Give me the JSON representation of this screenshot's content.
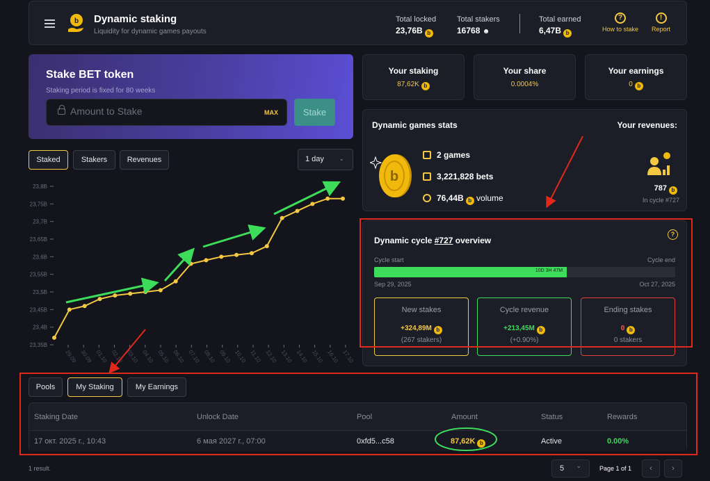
{
  "header": {
    "title": "Dynamic staking",
    "subtitle": "Liquidity for dynamic games payouts",
    "total_locked_label": "Total locked",
    "total_locked_value": "23,76B",
    "total_stakers_label": "Total stakers",
    "total_stakers_value": "16768",
    "total_earned_label": "Total earned",
    "total_earned_value": "6,47B",
    "how_to_stake": "How to stake",
    "report": "Report"
  },
  "stake": {
    "title": "Stake BET token",
    "subtitle": "Staking period is fixed for 80 weeks",
    "placeholder": "Amount to Stake",
    "max_label": "MAX",
    "button": "Stake"
  },
  "chart_tabs": [
    "Staked",
    "Stakers",
    "Revenues"
  ],
  "period": "1 day",
  "stat_cards": {
    "your_staking_label": "Your staking",
    "your_staking_value": "87,62K",
    "your_share_label": "Your share",
    "your_share_value": "0.0004%",
    "your_earnings_label": "Your earnings",
    "your_earnings_value": "0"
  },
  "games": {
    "title": "Dynamic games stats",
    "revenues_title": "Your revenues:",
    "games_count": "2 games",
    "bets": "3,221,828 bets",
    "volume_value": "76,44B",
    "volume_label": "volume",
    "revenue_value": "787",
    "revenue_cycle": "In cycle #727"
  },
  "cycle": {
    "title_pre": "Dynamic cycle",
    "title_link": "#727",
    "title_post": "overview",
    "start_label": "Cycle start",
    "end_label": "Cycle end",
    "remaining": "10D 3H 47M",
    "progress": 0.64,
    "start_date": "Sep 29, 2025",
    "end_date": "Oct 27, 2025",
    "new_stakes_label": "New stakes",
    "new_stakes_value": "+324,89M",
    "new_stakes_sub": "(267 stakers)",
    "cycle_revenue_label": "Cycle revenue",
    "cycle_revenue_value": "+213,45M",
    "cycle_revenue_sub": "(+0.90%)",
    "ending_stakes_label": "Ending stakes",
    "ending_stakes_value": "0",
    "ending_stakes_sub": "0 stakers"
  },
  "bottom_tabs": [
    "Pools",
    "My Staking",
    "My Earnings"
  ],
  "table": {
    "headers": [
      "Staking Date",
      "Unlock Date",
      "Pool",
      "Amount",
      "Status",
      "Rewards"
    ],
    "row": {
      "staking_date": "17 окт. 2025 г., 10:43",
      "unlock_date": "6 мая 2027 г., 07:00",
      "pool": "0xfd5...c58",
      "amount": "87,62K",
      "status": "Active",
      "rewards": "0.00%"
    }
  },
  "footer": {
    "results": "1 result.",
    "page_size": "5",
    "page_info": "Page 1 of 1"
  },
  "colors": {
    "accent": "#f5c842",
    "green": "#3ddc5a",
    "red": "#ff5a4a",
    "bg": "#13141c",
    "card": "#1b1d27"
  },
  "chart_data": {
    "type": "line",
    "x": [
      "29.09",
      "30.09",
      "01.10",
      "02.10",
      "03.10",
      "04.10",
      "05.10",
      "06.10",
      "07.10",
      "08.10",
      "09.10",
      "10.10",
      "11.10",
      "12.10",
      "13.10",
      "14.10",
      "15.10",
      "16.10",
      "17.10"
    ],
    "y_ticks": [
      "23,35B",
      "23,4B",
      "23,45B",
      "23,5B",
      "23,55B",
      "23,6B",
      "23,65B",
      "23,7B",
      "23,75B",
      "23,8B"
    ],
    "values": [
      23.37,
      23.45,
      23.46,
      23.48,
      23.49,
      23.495,
      23.5,
      23.505,
      23.53,
      23.58,
      23.59,
      23.6,
      23.605,
      23.61,
      23.63,
      23.71,
      23.73,
      23.75,
      23.765,
      23.765
    ],
    "ylim": [
      23.35,
      23.8
    ]
  }
}
